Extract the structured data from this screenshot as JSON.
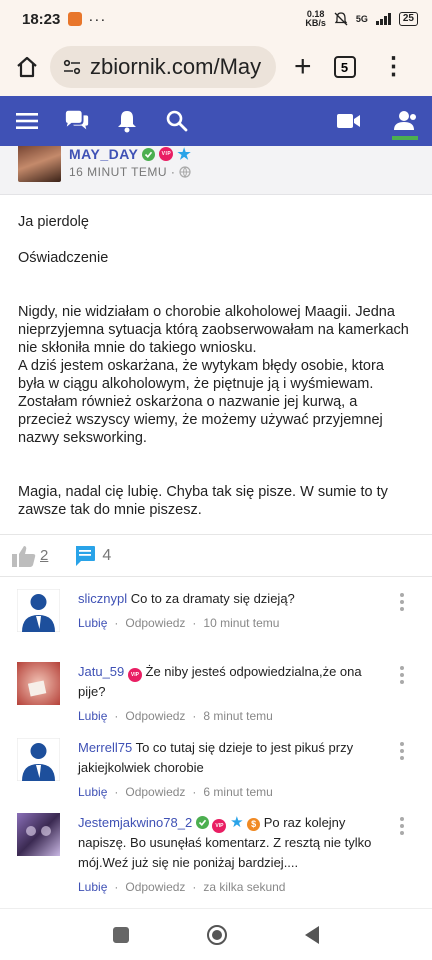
{
  "status": {
    "time": "18:23",
    "net_speed": "0.18",
    "net_unit": "KB/s",
    "net_type": "5G",
    "battery": "25"
  },
  "browser": {
    "url": "zbiornik.com/May",
    "tab_count": "5"
  },
  "post": {
    "author": "MAY_DAY",
    "time": "16 MINUT TEMU ·",
    "lines": {
      "l1": "Ja pierdolę",
      "l2": "Oświadczenie",
      "l3": "Nigdy, nie widziałam o chorobie alkoholowej Maagii. Jedna nieprzyjemna sytuacja którą zaobserwowałam na kamerkach nie skłoniła mnie do takiego wniosku.",
      "l4": "A dziś jestem oskarżana, że wytykam błędy osobie, ktora była w ciągu alkoholowym, że piętnuje ją i wyśmiewam.",
      "l5": "Zostałam również oskarżona o nazwanie jej kurwą, a przecież wszyscy wiemy, że możemy używać przyjemnej nazwy seksworking.",
      "l6": "Magia, nadal cię lubię. Chyba tak się pisze. W sumie to ty zawsze tak do mnie piszesz."
    },
    "likes": "2",
    "comments_count": "4"
  },
  "comments": [
    {
      "user": "slicznypl",
      "text": "Co to za dramaty się dzieją?",
      "like": "Lubię",
      "reply": "Odpowiedz",
      "time": "10 minut temu"
    },
    {
      "user": "Jatu_59",
      "text": "Że niby jesteś odpowiedzialna,że ona pije?",
      "like": "Lubię",
      "reply": "Odpowiedz",
      "time": "8 minut temu"
    },
    {
      "user": "Merrell75",
      "text": "To co tutaj się dzieje to jest pikuś przy jakiejkolwiek chorobie",
      "like": "Lubię",
      "reply": "Odpowiedz",
      "time": "6 minut temu"
    },
    {
      "user": "Jestemjakwino78_2",
      "text": "Po raz kolejny napiszę. Bo usunęłaś komentarz. Z resztą nie tylko mój.Weź już się nie poniżaj bardziej....",
      "like": "Lubię",
      "reply": "Odpowiedz",
      "time": "za kilka sekund"
    }
  ],
  "badges": {
    "vip": "VIP"
  },
  "colors": {
    "nav": "#3f51b5",
    "link": "#3f51b5",
    "verified": "#4caf50",
    "vip": "#e91e63",
    "star": "#29a3e8",
    "comment_icon": "#29a3e8"
  }
}
